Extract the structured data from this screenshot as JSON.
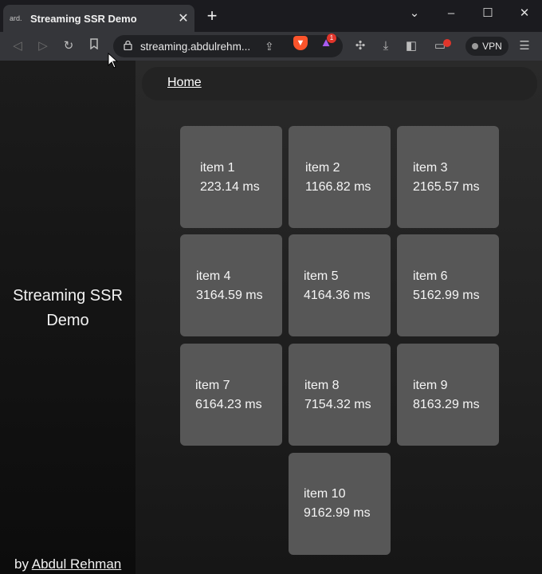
{
  "browser": {
    "tab": {
      "favicon_text": "ard.",
      "title": "Streaming SSR Demo"
    },
    "new_tab_label": "+",
    "address_bar": {
      "url": "streaming.abdulrehm..."
    },
    "rewards_badge": "1",
    "vpn_label": "VPN",
    "colors": {
      "brave": "#fb542b",
      "badge": "#e0352b"
    }
  },
  "sidebar": {
    "title": "Streaming SSR Demo",
    "credit_prefix": "by",
    "credit_link": "Abdul Rehman"
  },
  "nav": {
    "home_label": "Home"
  },
  "items": [
    {
      "name": "item 1",
      "time": "223.14 ms"
    },
    {
      "name": "item 2",
      "time": "1166.82 ms"
    },
    {
      "name": "item 3",
      "time": "2165.57 ms"
    },
    {
      "name": "item 4",
      "time": "3164.59 ms"
    },
    {
      "name": "item 5",
      "time": "4164.36 ms"
    },
    {
      "name": "item 6",
      "time": "5162.99 ms"
    },
    {
      "name": "item 7",
      "time": "6164.23 ms"
    },
    {
      "name": "item 8",
      "time": "7154.32 ms"
    },
    {
      "name": "item 9",
      "time": "8163.29 ms"
    },
    {
      "name": "item 10",
      "time": "9162.99 ms"
    }
  ]
}
